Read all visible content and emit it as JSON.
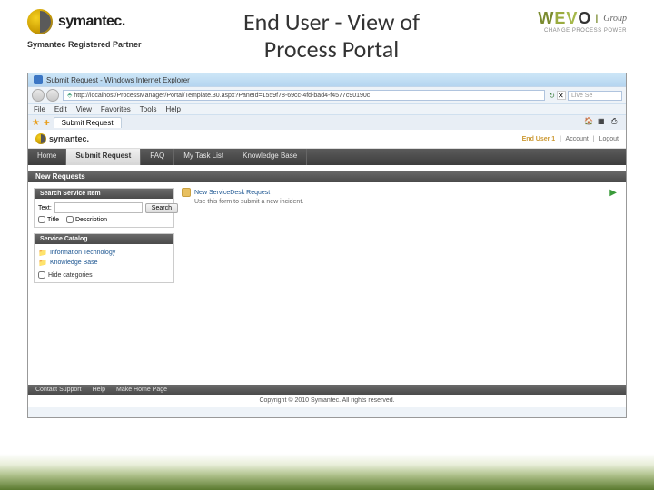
{
  "slide": {
    "title_line1": "End User - View of",
    "title_line2": "Process Portal",
    "symantec": "symantec.",
    "partner": "Symantec Registered Partner",
    "wevo_group": "Group",
    "wevo_tagline": "CHANGE PROCESS POWER"
  },
  "browser": {
    "window_title": "Submit Request - Windows Internet Explorer",
    "url": "http://localhost/ProcessManager/Portal/Template.30.aspx?PaneId=1559f78-69cc-4fd-bad4-f4577c90190c",
    "search_placeholder": "Live Se",
    "menu": {
      "file": "File",
      "edit": "Edit",
      "view": "View",
      "favorites": "Favorites",
      "tools": "Tools",
      "help": "Help"
    },
    "tab_label": "Submit Request"
  },
  "app": {
    "brand": "symantec.",
    "user": "End User 1",
    "account": "Account",
    "logout": "Logout",
    "nav": [
      "Home",
      "Submit Request",
      "FAQ",
      "My Task List",
      "Knowledge Base"
    ],
    "section_new_requests": "New Requests",
    "panel_search": "Search Service Item",
    "search_label": "Text:",
    "search_btn": "Search",
    "chk_title": "Title",
    "chk_desc": "Description",
    "panel_catalog": "Service Catalog",
    "catalog": [
      "Information Technology",
      "Knowledge Base"
    ],
    "hide_categories": "Hide categories",
    "req_title": "New ServiceDesk Request",
    "req_sub": "Use this form to submit a new incident.",
    "footer": [
      "Contact Support",
      "Help",
      "Make Home Page"
    ],
    "copyright": "Copyright © 2010 Symantec. All rights reserved."
  }
}
